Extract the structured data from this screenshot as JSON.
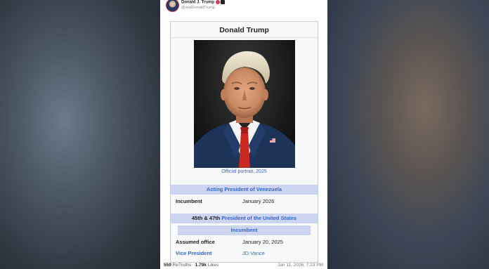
{
  "post": {
    "author_name": "Donald J. Trump",
    "author_handle": "@realDonaldTrump",
    "retruths_count": "559",
    "retruths_label": "ReTruths",
    "likes_count": "1.79k",
    "likes_label": "Likes",
    "timestamp": "Jan 11, 2026, 7:23 PM"
  },
  "infobox": {
    "title": "Donald Trump",
    "portrait_caption": "Official portrait, 2025",
    "role1_prefix": "Acting",
    "role1_link": "President of Venezuela",
    "incumbent_label": "Incumbent",
    "incumbent_value": "January 2026",
    "role2_prefix": "45th & 47th",
    "role2_link": "President of the United States",
    "incumbent_band": "Incumbent",
    "assumed_office_label": "Assumed office",
    "assumed_office_value": "January 20, 2025",
    "vp_label": "Vice President",
    "vp_value": "JD Vance"
  },
  "colors": {
    "link": "#3366cc",
    "band": "#ccd4f0",
    "infobox_bg": "#f8f9fa"
  },
  "icons": {
    "avatar": "avatar-icon",
    "verified": "verified-badge-icon"
  }
}
